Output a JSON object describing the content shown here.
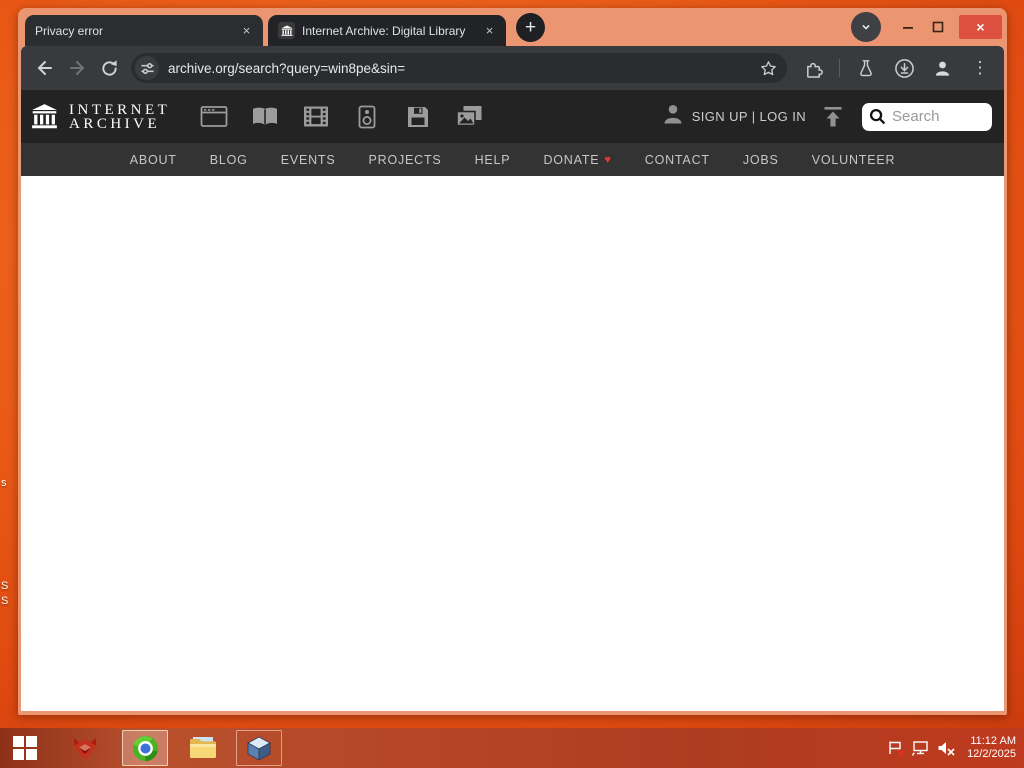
{
  "browser": {
    "tabs": [
      {
        "title": "Privacy error"
      },
      {
        "title": "Internet Archive: Digital Library"
      }
    ],
    "url": "archive.org/search?query=win8pe&sin="
  },
  "glyphs": {
    "close": "×",
    "plus": "+",
    "back": "←",
    "forward": "→",
    "reload": "↻",
    "menu_dots": "⋮",
    "heart": "♥"
  },
  "ia": {
    "wordmark_line1": "INTERNET",
    "wordmark_line2": "ARCHIVE",
    "auth": "SIGN UP | LOG IN",
    "search_placeholder": "Search",
    "nav": [
      "ABOUT",
      "BLOG",
      "EVENTS",
      "PROJECTS",
      "HELP",
      "DONATE",
      "CONTACT",
      "JOBS",
      "VOLUNTEER"
    ],
    "media_types": [
      "web",
      "texts",
      "video",
      "audio",
      "software",
      "images"
    ]
  },
  "taskbar": {
    "time": "11:12 AM",
    "date": "12/2/2025"
  },
  "desktop": {
    "fragments": [
      "s",
      "S",
      "S"
    ]
  },
  "colors": {
    "desktop_orange": "#e8551a",
    "frame_salmon": "#eb9671",
    "close_red": "#dd5040",
    "heart_red": "#e8392a",
    "header_dark": "#232323",
    "nav_dark": "#333333",
    "taskbar_red": "#b44526"
  }
}
